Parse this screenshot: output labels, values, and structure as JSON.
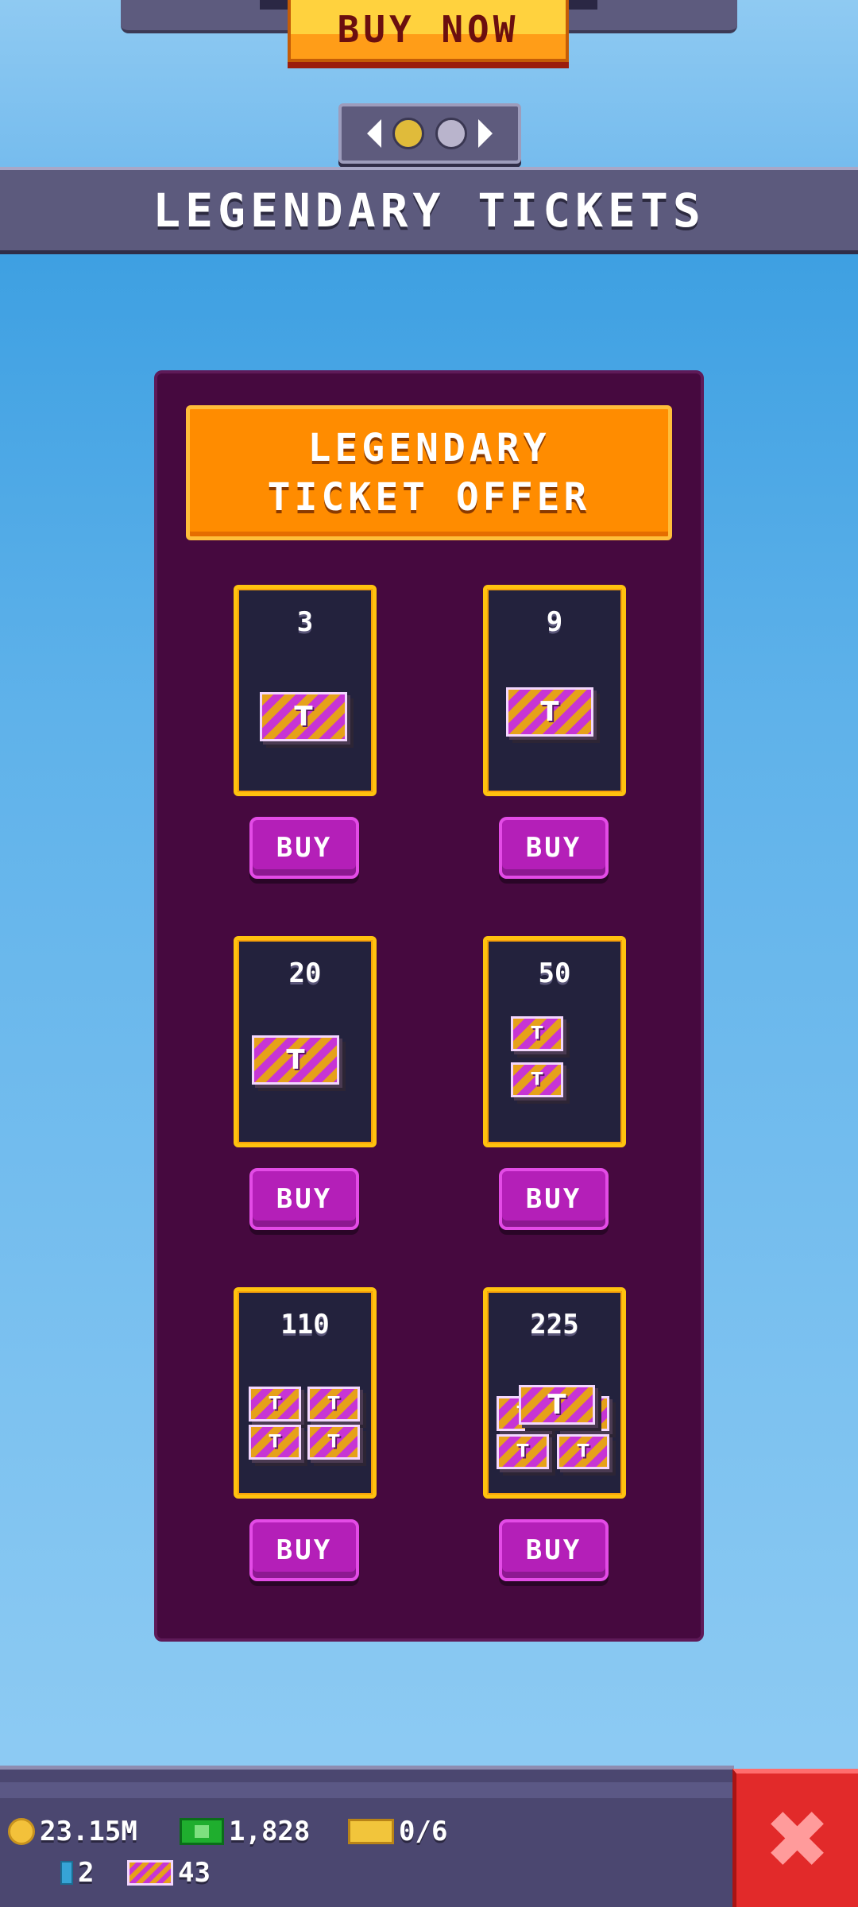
{
  "banner": {
    "buy_now_label": "BUY NOW"
  },
  "pager": {
    "pages": 2,
    "active_page": 1
  },
  "title": "LEGENDARY TICKETS",
  "offer": {
    "header": "LEGENDARY\nTICKET OFFER",
    "packs": [
      {
        "qty": "3",
        "buy_label": "BUY"
      },
      {
        "qty": "9",
        "buy_label": "BUY"
      },
      {
        "qty": "20",
        "buy_label": "BUY"
      },
      {
        "qty": "50",
        "buy_label": "BUY"
      },
      {
        "qty": "110",
        "buy_label": "BUY"
      },
      {
        "qty": "225",
        "buy_label": "BUY"
      }
    ]
  },
  "resources": {
    "coins": "23.15M",
    "cash": "1,828",
    "gold_tickets": "0/6",
    "gems": "2",
    "legendary_tickets": "43"
  },
  "icons": {
    "coins": "coin-icon",
    "cash": "cash-icon",
    "gold_tickets": "gold-ticket-icon",
    "gems": "gem-icon",
    "legendary_tickets": "legendary-ticket-icon",
    "close": "close-icon"
  },
  "colors": {
    "accent_orange": "#ff8c00",
    "panel_purple": "#46093f",
    "buy_magenta": "#b41fb8",
    "card_border_gold": "#ffc20e",
    "close_red": "#e22a2a"
  }
}
